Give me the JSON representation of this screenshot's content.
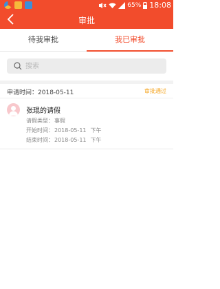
{
  "status_bar": {
    "battery": "65%",
    "time": "18:08",
    "app_icon_colors": [
      "#e84a2c",
      "#f6b93b",
      "#3d8fd9"
    ]
  },
  "header": {
    "title": "审批",
    "back_icon": "chevron-left-icon"
  },
  "tabs": [
    {
      "label": "待我审批",
      "active": false
    },
    {
      "label": "我已审批",
      "active": true
    }
  ],
  "search": {
    "placeholder": "搜索"
  },
  "records": [
    {
      "apply_time_label": "申请时间：",
      "apply_time": "2018-05-11",
      "status": "审批通过",
      "title": "张琨的请假",
      "leave_type_label": "请假类型：",
      "leave_type": "事假",
      "start_label": "开始时间：",
      "start_date": "2018-05-11",
      "start_period": "下午",
      "end_label": "结束时间：",
      "end_date": "2018-05-11",
      "end_period": "下午"
    }
  ],
  "colors": {
    "accent": "#f24c2c",
    "status_approved": "#f5a623",
    "avatar_bg": "#f8c8cc"
  }
}
